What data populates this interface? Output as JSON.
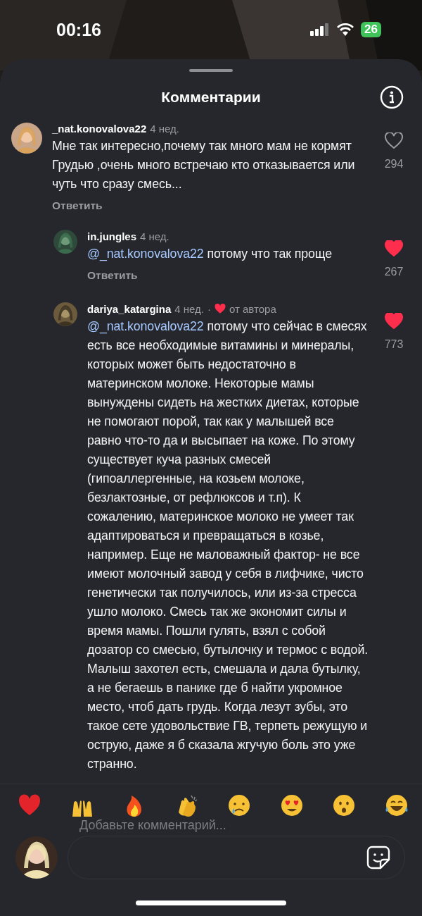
{
  "status_bar": {
    "time": "00:16",
    "battery": "26"
  },
  "sheet": {
    "title": "Комментарии"
  },
  "comments": [
    {
      "user": "_nat.konovalova22",
      "age": "4 нед.",
      "author_liked": false,
      "text": "Мне так интересно,почему так много мам не кормят Грудью ,очень много встречаю кто отказывается или чуть что сразу смесь...",
      "reply": "Ответить",
      "liked": false,
      "likes": "294",
      "reply_level": false
    },
    {
      "user": "in.jungles",
      "age": "4 нед.",
      "author_liked": false,
      "mention": "@_nat.konovalova22",
      "text": "потому что так проще",
      "reply": "Ответить",
      "liked": true,
      "likes": "267",
      "reply_level": true
    },
    {
      "user": "dariya_katargina",
      "age": "4 нед.",
      "author_liked": true,
      "separator": "·",
      "author_label": "от автора",
      "mention": "@_nat.konovalova22",
      "text": "потому что сейчас в смесях есть все необходимые витамины и минералы, которых может быть недостаточно в материнском молоке. Некоторые мамы вынуждены  сидеть на жестких диетах, которые не помогают порой, так как у малышей все равно что-то да и высыпает на коже. По этому существует куча разных смесей (гипоаллергенные, на козьем молоке, безлактозные, от рефлюксов и т.п). К сожалению, материнское молоко не умеет так адаптироваться и превращаться в козье, например. Еще не маловажный фактор- не все имеют молочный завод у себя в лифчике, чисто генетически так получилось, или из-за стресса ушло молоко. Смесь так же экономит силы и время мамы. Пошли гулять, взял с собой дозатор со смесью, бутылочку и термос с водой. Малыш захотел есть, смешала и дала бутылку, а не бегаешь в панике где б найти укромное место, чтоб дать грудь. Когда лезут зубы, это такое сете удовольствие ГВ, терпеть режущую и острую, даже я б сказала жгучую боль это уже странно.",
      "liked": true,
      "likes": "773",
      "reply_level": true
    }
  ],
  "composer": {
    "placeholder": "Добавьте комментарий..."
  }
}
